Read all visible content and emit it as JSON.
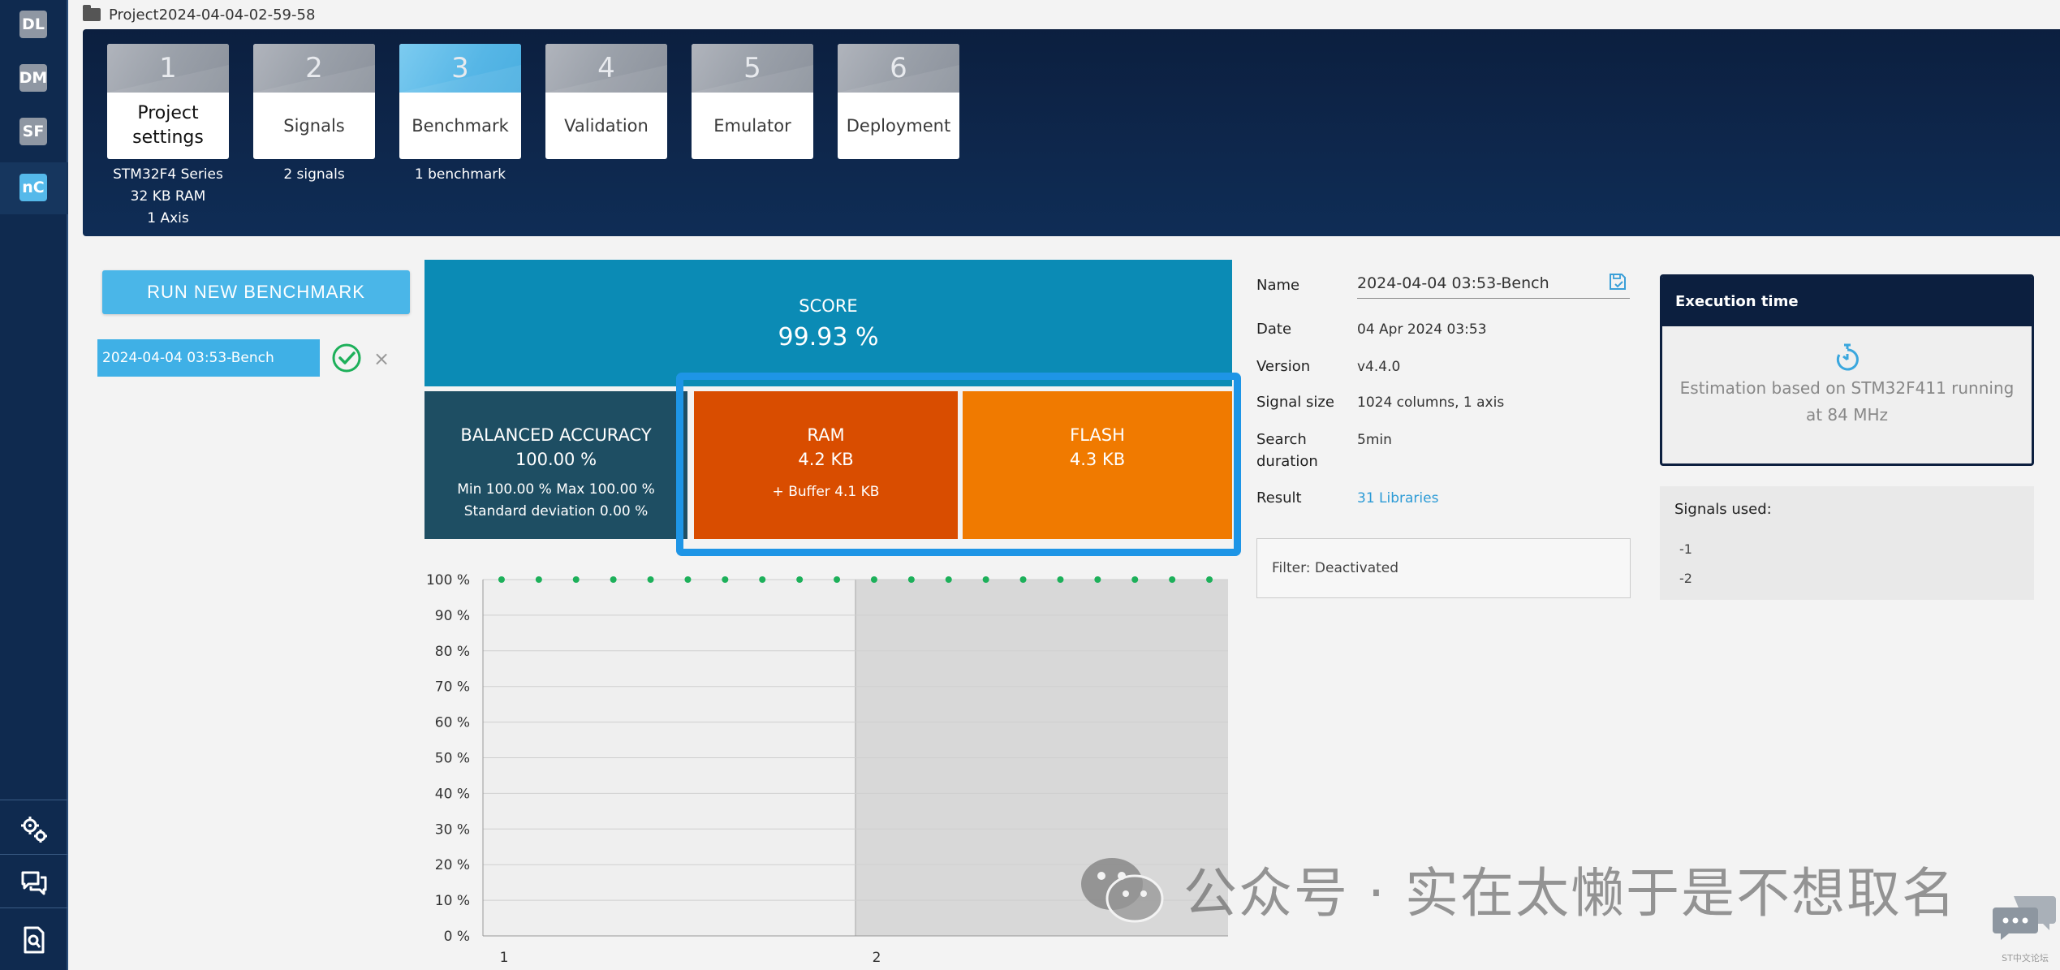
{
  "rail": {
    "badges": [
      "DL",
      "DM",
      "SF",
      "nC"
    ],
    "active": "nC",
    "bottom_icons": [
      "gear-icon",
      "chat-icon",
      "search-doc-icon"
    ]
  },
  "path": {
    "label": "Project2024-04-04-02-59-58"
  },
  "steps": [
    {
      "num": "1",
      "label": "Project settings",
      "sub": [
        "STM32F4 Series",
        "32 KB RAM",
        "1 Axis"
      ]
    },
    {
      "num": "2",
      "label": "Signals",
      "sub": [
        "2 signals"
      ]
    },
    {
      "num": "3",
      "label": "Benchmark",
      "sub": [
        "1 benchmark"
      ]
    },
    {
      "num": "4",
      "label": "Validation",
      "sub": []
    },
    {
      "num": "5",
      "label": "Emulator",
      "sub": []
    },
    {
      "num": "6",
      "label": "Deployment",
      "sub": []
    }
  ],
  "left": {
    "run_button": "RUN NEW BENCHMARK",
    "benchmark_item": "2024-04-04 03:53-Bench",
    "close_glyph": "×"
  },
  "score": {
    "title": "SCORE",
    "value": "99.93 %"
  },
  "balanced": {
    "title": "BALANCED ACCURACY",
    "value": "100.00 %",
    "minmax": "Min 100.00 % Max 100.00 %",
    "stddev": "Standard deviation 0.00 %"
  },
  "ram": {
    "title": "RAM",
    "value": "4.2 KB",
    "buffer": "+ Buffer 4.1 KB"
  },
  "flash": {
    "title": "FLASH",
    "value": "4.3 KB"
  },
  "details": {
    "name_label": "Name",
    "name_value": "2024-04-04 03:53-Bench",
    "date_label": "Date",
    "date_value": "04 Apr 2024 03:53",
    "version_label": "Version",
    "version_value": "v4.4.0",
    "signal_size_label": "Signal size",
    "signal_size_value": "1024 columns, 1 axis",
    "search_label_1": "Search",
    "search_label_2": "duration",
    "search_value": "5min",
    "result_label": "Result",
    "result_value": "31 Libraries",
    "filter": "Filter: Deactivated"
  },
  "exec": {
    "title": "Execution time",
    "line1": "Estimation based on STM32F411 running",
    "line2": "at 84 MHz"
  },
  "signals": {
    "title": "Signals used:",
    "items": [
      "-1",
      "-2"
    ]
  },
  "watermark": {
    "text": "公众号 · 实在太懒于是不想取名",
    "logo_caption": "ST中文论坛"
  },
  "colors": {
    "rail": "#0f2a4f",
    "banner": "#0c1f3f",
    "accent": "#4ab6e8",
    "score": "#0b8bb5",
    "balanced": "#1e4e63",
    "ram": "#d94d00",
    "flash": "#f07a00",
    "highlight": "#1e95e6",
    "points": "#1db05a"
  },
  "chart_data": {
    "type": "scatter",
    "y_ticks": [
      "100 %",
      "90 %",
      "80 %",
      "70 %",
      "60 %",
      "50 %",
      "40 %",
      "30 %",
      "20 %",
      "10 %",
      "0 %"
    ],
    "x_ticks": [
      "1",
      "2"
    ],
    "ylim": [
      0,
      100
    ],
    "points_per_signal": 10,
    "series": [
      {
        "signal": "1",
        "values": [
          100,
          100,
          100,
          100,
          100,
          100,
          100,
          100,
          100,
          100
        ]
      },
      {
        "signal": "2",
        "values": [
          100,
          100,
          100,
          100,
          100,
          100,
          100,
          100,
          100,
          100
        ]
      }
    ],
    "grid": true
  }
}
